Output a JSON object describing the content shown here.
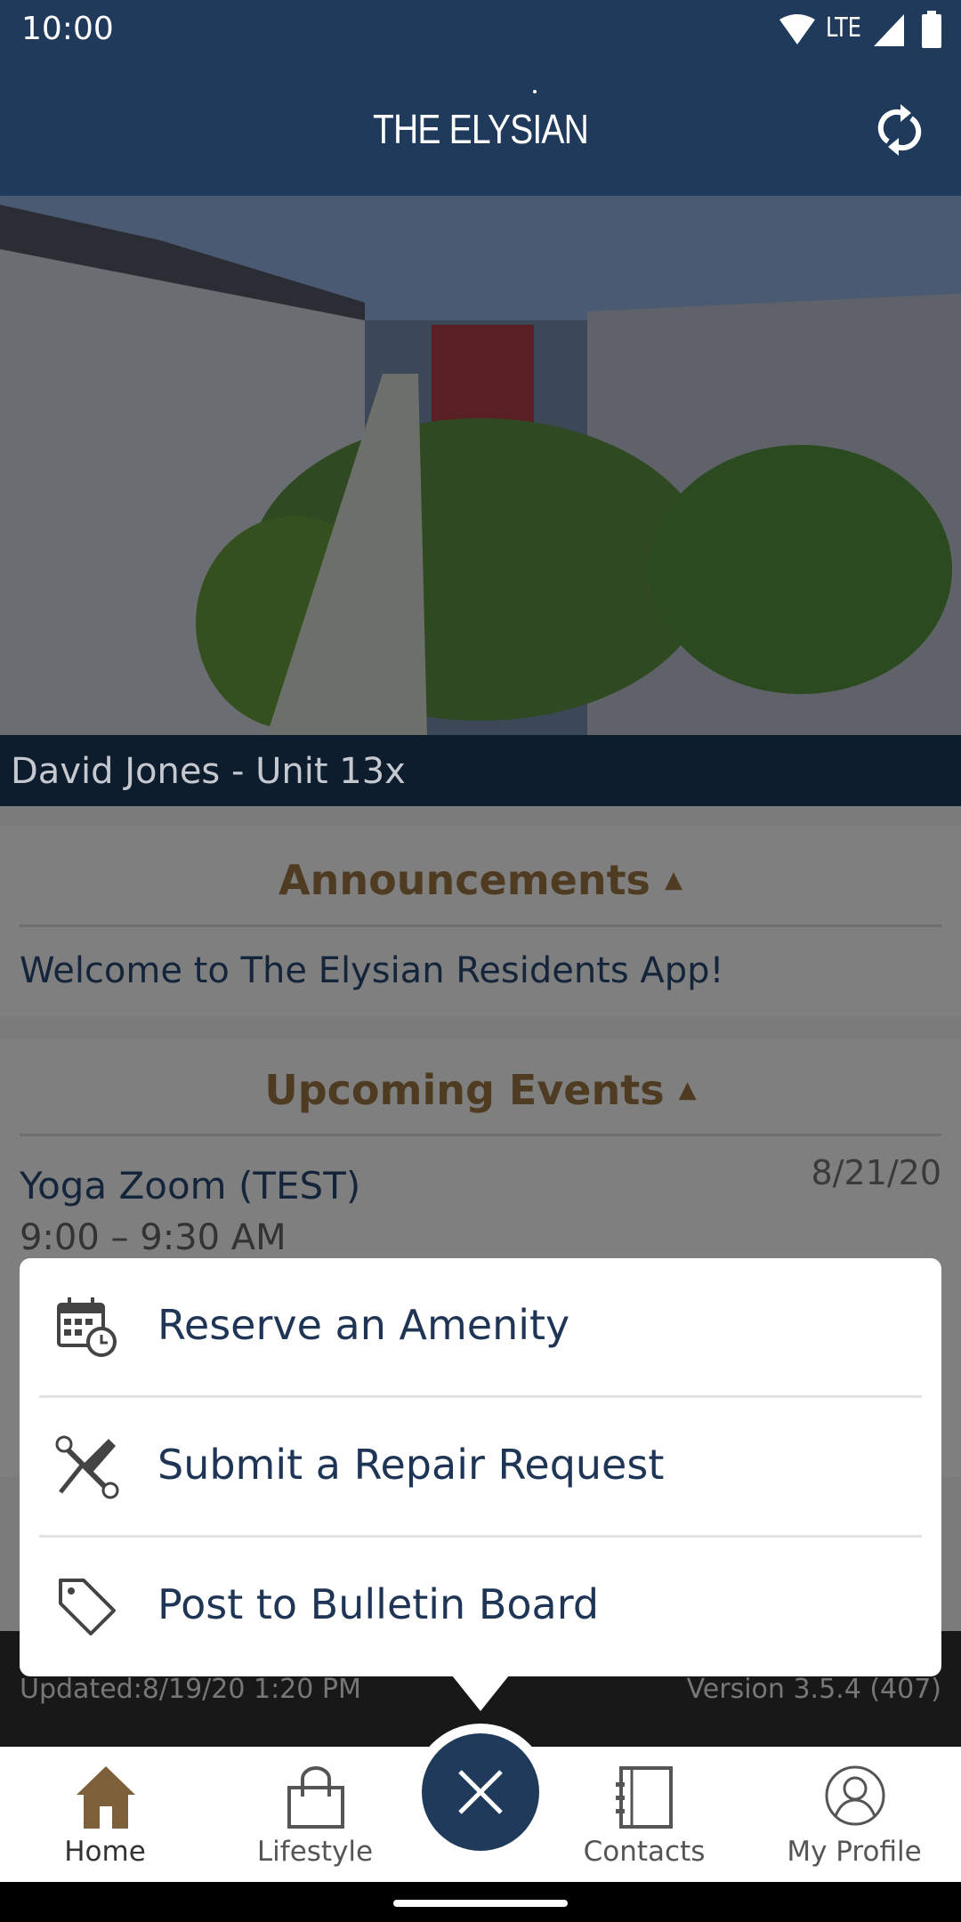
{
  "status_bar": {
    "time": "10:00",
    "network": "LTE",
    "icons": [
      "wifi-icon",
      "signal-icon",
      "battery-icon"
    ]
  },
  "header": {
    "title": "THE ELYSIAN",
    "refresh_icon": "refresh-icon"
  },
  "resident": {
    "label": "David Jones - Unit 13x"
  },
  "announcements": {
    "title": "Announcements",
    "items": [
      "Welcome to The Elysian Residents App!"
    ]
  },
  "events": {
    "title": "Upcoming Events",
    "items": [
      {
        "name": "Yoga Zoom (TEST)",
        "time": "9:00 – 9:30 AM",
        "date": "8/21/20"
      }
    ]
  },
  "footer": {
    "updated": "Updated:8/19/20 1:20 PM",
    "version": "Version 3.5.4 (407)"
  },
  "quick_menu": {
    "items": [
      {
        "label": "Reserve an Amenity",
        "icon": "calendar-clock-icon"
      },
      {
        "label": "Submit a Repair Request",
        "icon": "tools-icon"
      },
      {
        "label": "Post to Bulletin Board",
        "icon": "tag-icon"
      }
    ]
  },
  "bottom_nav": {
    "items": [
      {
        "label": "Home",
        "icon": "home-icon",
        "active": true
      },
      {
        "label": "Lifestyle",
        "icon": "shopping-bag-icon"
      },
      {
        "label": "Contacts",
        "icon": "address-book-icon"
      },
      {
        "label": "My Profile",
        "icon": "profile-icon"
      }
    ],
    "fab_icon": "close-icon"
  },
  "colors": {
    "brand_navy": "#203a5b",
    "accent_brown": "#7d5f3a"
  }
}
